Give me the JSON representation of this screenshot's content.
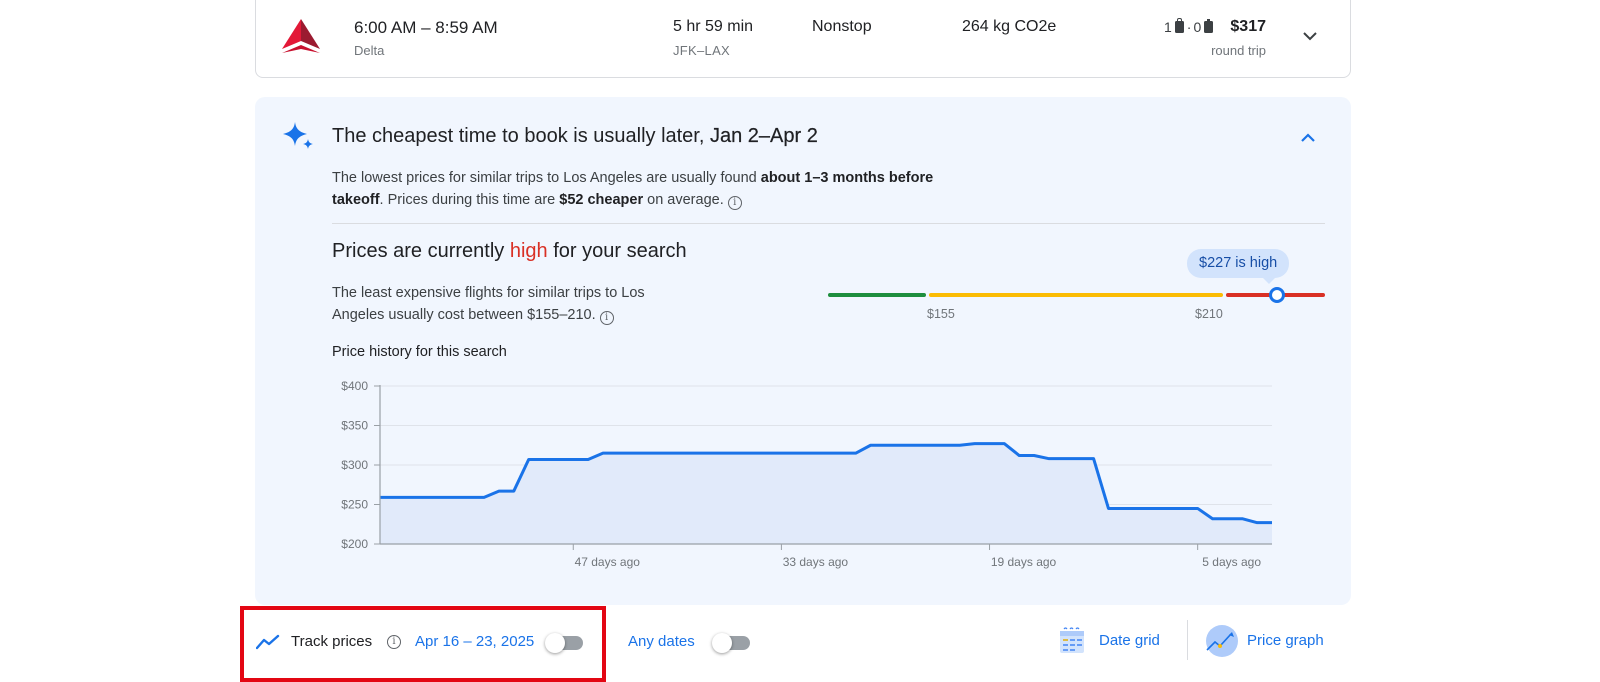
{
  "flight": {
    "times": "6:00 AM – 8:59 AM",
    "airline": "Delta",
    "duration": "5 hr 59 min",
    "route": "JFK–LAX",
    "stops": "Nonstop",
    "emissions": "264 kg CO2e",
    "carry_on_count": "1",
    "checked_count": "0",
    "price": "$317",
    "price_type": "round trip"
  },
  "insights": {
    "cheap_title_prefix": "The cheapest time to book is usually later, ",
    "cheap_title_range": "Jan 2–Apr 2",
    "cheap_desc_1": "The lowest prices for similar trips to Los Angeles are usually found ",
    "cheap_desc_bold_1": "about 1–3 months before takeoff",
    "cheap_desc_2": ". Prices during this time are ",
    "cheap_desc_bold_2": "$52 cheaper",
    "cheap_desc_3": " on average.",
    "high_title_prefix": "Prices are currently ",
    "high_title_level": "high",
    "high_title_suffix": " for your search",
    "range_desc": "The least expensive flights for similar trips to Los Angeles usually cost between $155–210.",
    "meter_low_label": "$155",
    "meter_high_label": "$210",
    "current_price_bubble": "$227 is high",
    "current_price": 227,
    "history_title": "Price history for this search",
    "colors": {
      "low": "#1e8e3e",
      "typical": "#fbbc04",
      "high": "#d93025",
      "line": "#1a73e8"
    }
  },
  "chart_data": {
    "type": "area",
    "title": "Price history for this search",
    "xlabel": "",
    "ylabel": "",
    "x_unit": "days ago",
    "xlim": [
      60,
      0
    ],
    "ylim": [
      200,
      400
    ],
    "yticks": [
      200,
      250,
      300,
      350,
      400
    ],
    "ytick_labels": [
      "$200",
      "$250",
      "$300",
      "$350",
      "$400"
    ],
    "xticks": [
      47,
      33,
      19,
      5
    ],
    "xtick_labels": [
      "47 days ago",
      "33 days ago",
      "19 days ago",
      "5 days ago"
    ],
    "grid": true,
    "series": [
      {
        "name": "Price",
        "x": [
          60,
          53,
          52,
          51,
          50,
          46,
          45,
          28,
          27,
          21,
          20,
          18,
          17,
          16,
          15,
          12,
          11,
          5,
          4,
          2,
          1,
          0
        ],
        "values": [
          259,
          259,
          267,
          267,
          307,
          307,
          315,
          315,
          325,
          325,
          327,
          327,
          312,
          312,
          308,
          308,
          245,
          245,
          232,
          232,
          227,
          227
        ]
      }
    ]
  },
  "bottom": {
    "track_label": "Track prices",
    "track_dates": "Apr 16 – 23, 2025",
    "track_toggle_on": false,
    "any_dates_label": "Any dates",
    "any_dates_toggle_on": false,
    "date_grid_label": "Date grid",
    "price_graph_label": "Price graph"
  }
}
